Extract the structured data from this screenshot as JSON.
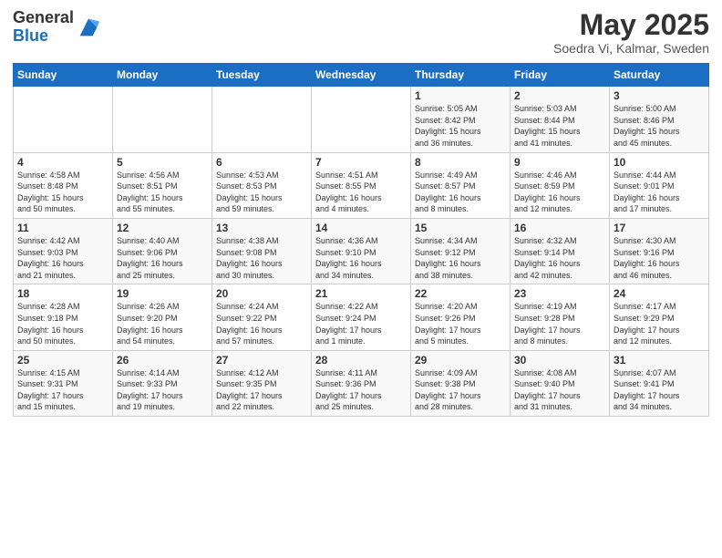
{
  "logo": {
    "general": "General",
    "blue": "Blue"
  },
  "title": "May 2025",
  "subtitle": "Soedra Vi, Kalmar, Sweden",
  "headers": [
    "Sunday",
    "Monday",
    "Tuesday",
    "Wednesday",
    "Thursday",
    "Friday",
    "Saturday"
  ],
  "weeks": [
    [
      {
        "day": "",
        "info": ""
      },
      {
        "day": "",
        "info": ""
      },
      {
        "day": "",
        "info": ""
      },
      {
        "day": "",
        "info": ""
      },
      {
        "day": "1",
        "info": "Sunrise: 5:05 AM\nSunset: 8:42 PM\nDaylight: 15 hours\nand 36 minutes."
      },
      {
        "day": "2",
        "info": "Sunrise: 5:03 AM\nSunset: 8:44 PM\nDaylight: 15 hours\nand 41 minutes."
      },
      {
        "day": "3",
        "info": "Sunrise: 5:00 AM\nSunset: 8:46 PM\nDaylight: 15 hours\nand 45 minutes."
      }
    ],
    [
      {
        "day": "4",
        "info": "Sunrise: 4:58 AM\nSunset: 8:48 PM\nDaylight: 15 hours\nand 50 minutes."
      },
      {
        "day": "5",
        "info": "Sunrise: 4:56 AM\nSunset: 8:51 PM\nDaylight: 15 hours\nand 55 minutes."
      },
      {
        "day": "6",
        "info": "Sunrise: 4:53 AM\nSunset: 8:53 PM\nDaylight: 15 hours\nand 59 minutes."
      },
      {
        "day": "7",
        "info": "Sunrise: 4:51 AM\nSunset: 8:55 PM\nDaylight: 16 hours\nand 4 minutes."
      },
      {
        "day": "8",
        "info": "Sunrise: 4:49 AM\nSunset: 8:57 PM\nDaylight: 16 hours\nand 8 minutes."
      },
      {
        "day": "9",
        "info": "Sunrise: 4:46 AM\nSunset: 8:59 PM\nDaylight: 16 hours\nand 12 minutes."
      },
      {
        "day": "10",
        "info": "Sunrise: 4:44 AM\nSunset: 9:01 PM\nDaylight: 16 hours\nand 17 minutes."
      }
    ],
    [
      {
        "day": "11",
        "info": "Sunrise: 4:42 AM\nSunset: 9:03 PM\nDaylight: 16 hours\nand 21 minutes."
      },
      {
        "day": "12",
        "info": "Sunrise: 4:40 AM\nSunset: 9:06 PM\nDaylight: 16 hours\nand 25 minutes."
      },
      {
        "day": "13",
        "info": "Sunrise: 4:38 AM\nSunset: 9:08 PM\nDaylight: 16 hours\nand 30 minutes."
      },
      {
        "day": "14",
        "info": "Sunrise: 4:36 AM\nSunset: 9:10 PM\nDaylight: 16 hours\nand 34 minutes."
      },
      {
        "day": "15",
        "info": "Sunrise: 4:34 AM\nSunset: 9:12 PM\nDaylight: 16 hours\nand 38 minutes."
      },
      {
        "day": "16",
        "info": "Sunrise: 4:32 AM\nSunset: 9:14 PM\nDaylight: 16 hours\nand 42 minutes."
      },
      {
        "day": "17",
        "info": "Sunrise: 4:30 AM\nSunset: 9:16 PM\nDaylight: 16 hours\nand 46 minutes."
      }
    ],
    [
      {
        "day": "18",
        "info": "Sunrise: 4:28 AM\nSunset: 9:18 PM\nDaylight: 16 hours\nand 50 minutes."
      },
      {
        "day": "19",
        "info": "Sunrise: 4:26 AM\nSunset: 9:20 PM\nDaylight: 16 hours\nand 54 minutes."
      },
      {
        "day": "20",
        "info": "Sunrise: 4:24 AM\nSunset: 9:22 PM\nDaylight: 16 hours\nand 57 minutes."
      },
      {
        "day": "21",
        "info": "Sunrise: 4:22 AM\nSunset: 9:24 PM\nDaylight: 17 hours\nand 1 minute."
      },
      {
        "day": "22",
        "info": "Sunrise: 4:20 AM\nSunset: 9:26 PM\nDaylight: 17 hours\nand 5 minutes."
      },
      {
        "day": "23",
        "info": "Sunrise: 4:19 AM\nSunset: 9:28 PM\nDaylight: 17 hours\nand 8 minutes."
      },
      {
        "day": "24",
        "info": "Sunrise: 4:17 AM\nSunset: 9:29 PM\nDaylight: 17 hours\nand 12 minutes."
      }
    ],
    [
      {
        "day": "25",
        "info": "Sunrise: 4:15 AM\nSunset: 9:31 PM\nDaylight: 17 hours\nand 15 minutes."
      },
      {
        "day": "26",
        "info": "Sunrise: 4:14 AM\nSunset: 9:33 PM\nDaylight: 17 hours\nand 19 minutes."
      },
      {
        "day": "27",
        "info": "Sunrise: 4:12 AM\nSunset: 9:35 PM\nDaylight: 17 hours\nand 22 minutes."
      },
      {
        "day": "28",
        "info": "Sunrise: 4:11 AM\nSunset: 9:36 PM\nDaylight: 17 hours\nand 25 minutes."
      },
      {
        "day": "29",
        "info": "Sunrise: 4:09 AM\nSunset: 9:38 PM\nDaylight: 17 hours\nand 28 minutes."
      },
      {
        "day": "30",
        "info": "Sunrise: 4:08 AM\nSunset: 9:40 PM\nDaylight: 17 hours\nand 31 minutes."
      },
      {
        "day": "31",
        "info": "Sunrise: 4:07 AM\nSunset: 9:41 PM\nDaylight: 17 hours\nand 34 minutes."
      }
    ]
  ]
}
